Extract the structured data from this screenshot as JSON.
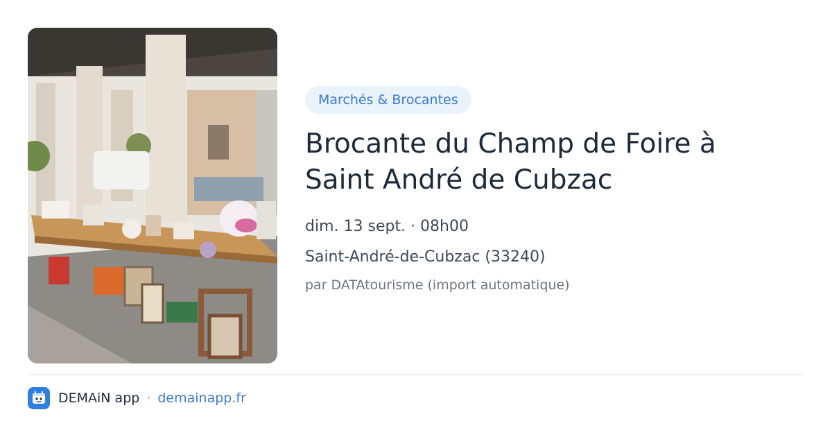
{
  "event": {
    "category": "Marchés & Brocantes",
    "title": "Brocante du Champ de Foire à Saint André de Cubzac",
    "datetime": "dim. 13 sept. · 08h00",
    "location": "Saint-André-de-Cubzac (33240)",
    "source": "par DATAtourisme (import automatique)"
  },
  "footer": {
    "app_name": "DEMAiN app",
    "separator": "·",
    "url": "demainapp.fr"
  },
  "colors": {
    "accent": "#3b7bd4",
    "badge_bg": "#eaf2fb",
    "app_icon": "#2f7fe0"
  }
}
